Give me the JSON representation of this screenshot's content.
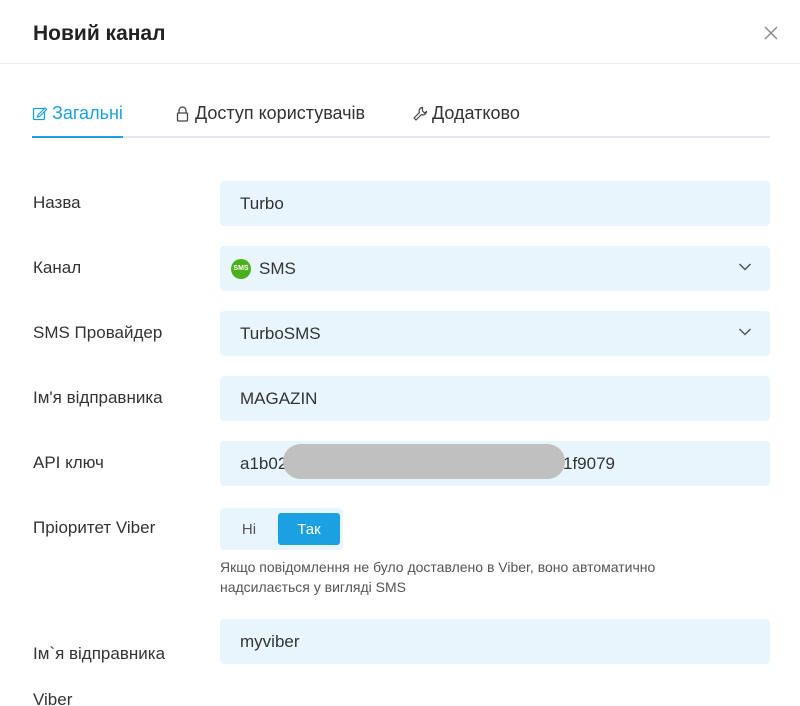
{
  "dialog": {
    "title": "Новий канал"
  },
  "tabs": [
    {
      "label": "Загальні",
      "icon": "edit-icon",
      "active": true
    },
    {
      "label": "Доступ користувачів",
      "icon": "lock-icon",
      "active": false
    },
    {
      "label": "Додатково",
      "icon": "wrench-icon",
      "active": false
    }
  ],
  "form": {
    "name": {
      "label": "Назва",
      "value": "Turbo"
    },
    "channel": {
      "label": "Канал",
      "value": "SMS",
      "badge": "SMS"
    },
    "provider": {
      "label": "SMS Провайдер",
      "value": "TurboSMS"
    },
    "sender": {
      "label": "Ім'я відправника",
      "value": "MAGAZIN"
    },
    "api_key": {
      "label": "API ключ",
      "value_start": "a1b02",
      "value_end": "1f9079"
    },
    "viber_priority": {
      "label": "Пріоритет Viber",
      "option_no": "Ні",
      "option_yes": "Так",
      "selected": "Так",
      "hint": "Якщо повідомлення не було доставлено в Viber, воно автоматично надсилається у вигляді SMS"
    },
    "viber_sender": {
      "label": "Ім`я відправника Viber",
      "value": "myviber"
    }
  },
  "colors": {
    "accent": "#1ba1e2",
    "field_bg": "#e8f5fd",
    "sms_badge": "#4caf1c"
  }
}
